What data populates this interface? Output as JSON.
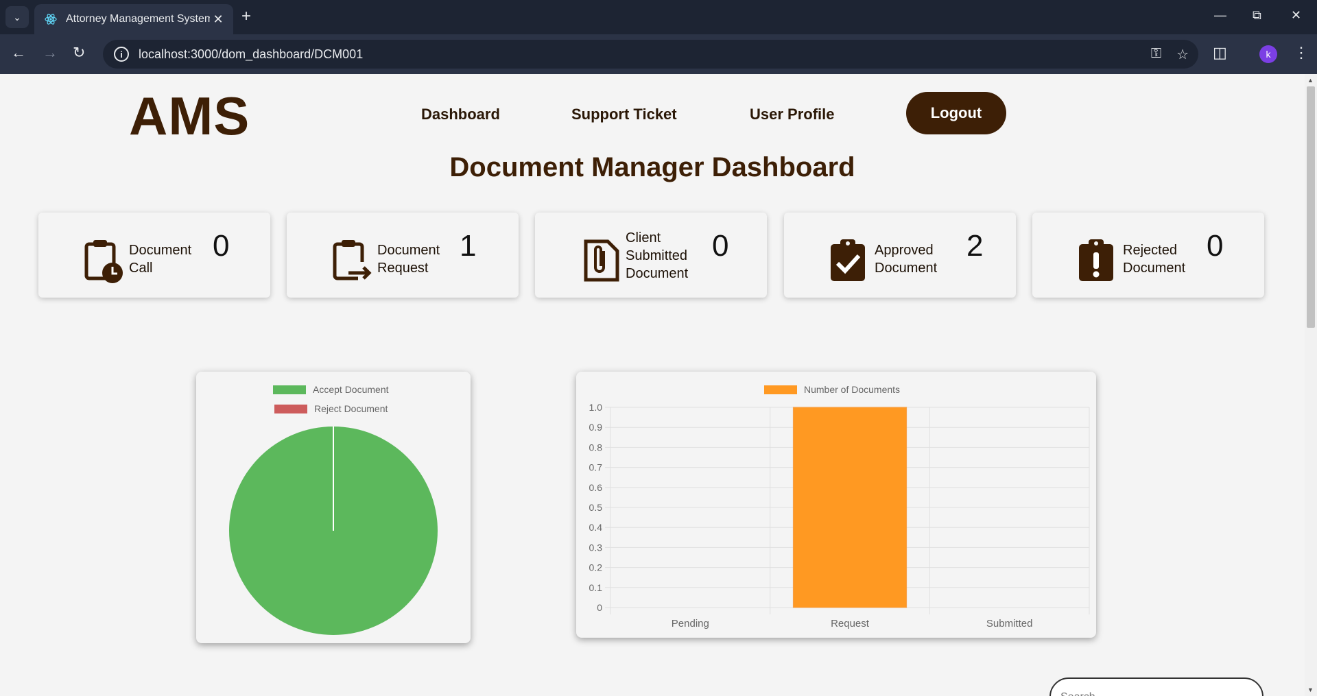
{
  "browser": {
    "tab_title": "Attorney Management System (",
    "url": "localhost:3000/dom_dashboard/DCM001",
    "profile_initial": "k"
  },
  "header": {
    "brand": "AMS",
    "nav": [
      "Dashboard",
      "Support Ticket",
      "User Profile"
    ],
    "logout_label": "Logout"
  },
  "page_title": "Document Manager Dashboard",
  "cards": [
    {
      "label_lines": [
        "Document",
        "Call"
      ],
      "count": "0",
      "icon": "clipboard-clock-icon"
    },
    {
      "label_lines": [
        "Document",
        "Request"
      ],
      "count": "1",
      "icon": "clipboard-arrow-icon"
    },
    {
      "label_lines": [
        "Client",
        "Submitted",
        "Document"
      ],
      "count": "0",
      "icon": "file-paperclip-icon"
    },
    {
      "label_lines": [
        "Approved",
        "Document"
      ],
      "count": "2",
      "icon": "clipboard-check-icon"
    },
    {
      "label_lines": [
        "Rejected",
        "Document"
      ],
      "count": "0",
      "icon": "clipboard-exclamation-icon"
    }
  ],
  "colors": {
    "brand": "#3d1f06",
    "accept": "#5cb85c",
    "reject": "#cd5c5c",
    "bar": "#ff9922"
  },
  "chart_data": [
    {
      "type": "pie",
      "categories": [
        "Accept Document",
        "Reject Document"
      ],
      "values": [
        2,
        0
      ],
      "legend_placement": "top"
    },
    {
      "type": "bar",
      "categories": [
        "Pending",
        "Request",
        "Submitted"
      ],
      "series": [
        {
          "name": "Number of Documents",
          "values": [
            0,
            1,
            0
          ]
        }
      ],
      "ylim": [
        0,
        1.0
      ],
      "yticks": [
        "1.0",
        "0.9",
        "0.8",
        "0.7",
        "0.6",
        "0.5",
        "0.4",
        "0.3",
        "0.2",
        "0.1",
        "0"
      ],
      "grid": true,
      "legend_placement": "top"
    }
  ],
  "search": {
    "placeholder": "Search"
  }
}
